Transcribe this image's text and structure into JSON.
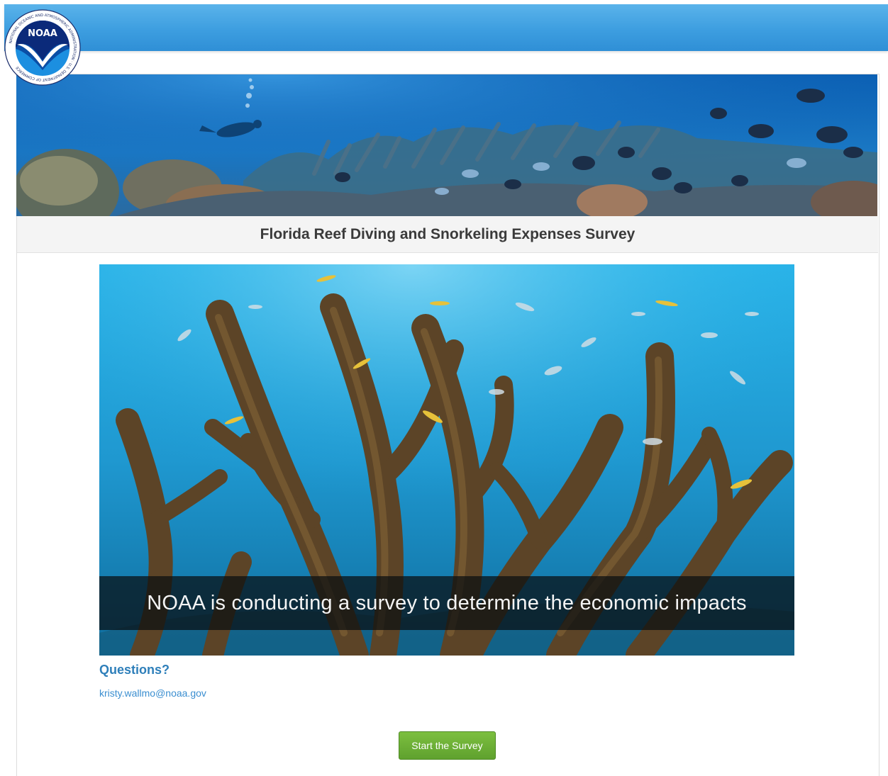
{
  "header": {
    "logo_text": "NOAA",
    "logo_ring_text": "NATIONAL OCEANIC AND ATMOSPHERIC ADMINISTRATION · U.S. DEPARTMENT OF COMMERCE",
    "bar_color": "#3d9ee0"
  },
  "survey": {
    "title": "Florida Reef Diving and Snorkeling Expenses Survey"
  },
  "video": {
    "caption": "NOAA is conducting a survey to determine the economic impacts"
  },
  "contact": {
    "heading": "Questions?",
    "email": "kristy.wallmo@noaa.gov"
  },
  "actions": {
    "start_label": "Start the Survey",
    "start_color": "#5fa12e"
  }
}
